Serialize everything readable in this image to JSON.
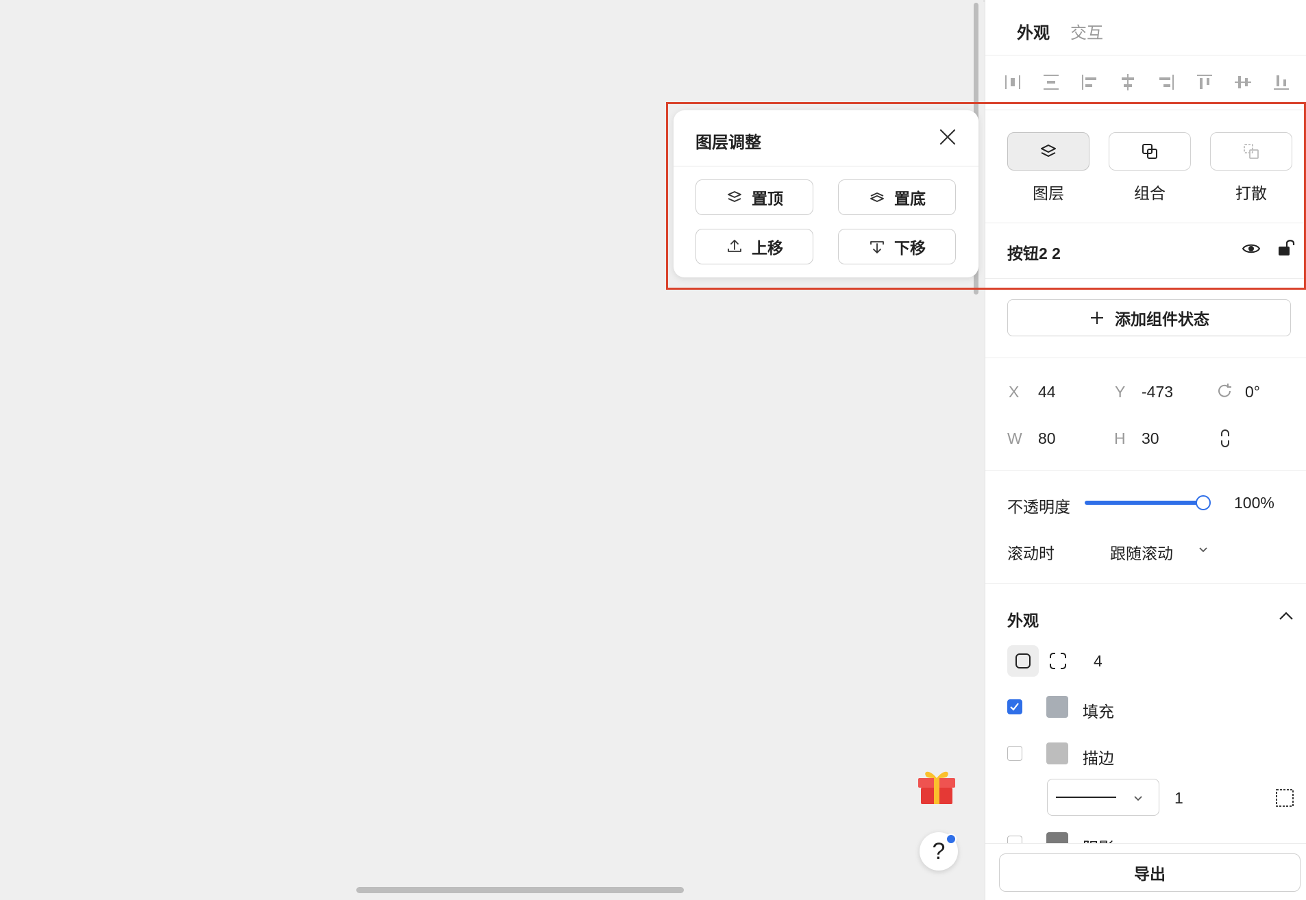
{
  "popover": {
    "title": "图层调整",
    "buttons": [
      {
        "label": "置顶",
        "icon": "bring-to-front-icon"
      },
      {
        "label": "置底",
        "icon": "send-to-back-icon"
      },
      {
        "label": "上移",
        "icon": "move-up-icon"
      },
      {
        "label": "下移",
        "icon": "move-down-icon"
      }
    ]
  },
  "panel": {
    "tabs": [
      {
        "label": "外观",
        "active": true
      },
      {
        "label": "交互",
        "active": false
      }
    ],
    "align_icons": [
      "distribute-horizontal-icon",
      "distribute-vertical-icon",
      "align-left-icon",
      "align-center-horizontal-icon",
      "align-right-icon",
      "align-top-icon",
      "align-middle-vertical-icon",
      "align-bottom-icon"
    ],
    "group_actions": [
      {
        "label": "图层",
        "icon": "layers-icon",
        "active": true
      },
      {
        "label": "组合",
        "icon": "group-icon",
        "active": false
      },
      {
        "label": "打散",
        "icon": "ungroup-icon",
        "active": false
      }
    ],
    "layer_name": "按钮2 2",
    "add_state_label": "添加组件状态",
    "geometry": {
      "x_label": "X",
      "x_value": "44",
      "y_label": "Y",
      "y_value": "-473",
      "rotation_value": "0°",
      "w_label": "W",
      "w_value": "80",
      "h_label": "H",
      "h_value": "30"
    },
    "opacity": {
      "label": "不透明度",
      "value": "100%",
      "level": 1.0
    },
    "scroll": {
      "label": "滚动时",
      "value": "跟随滚动"
    },
    "appearance": {
      "title": "外观",
      "corner_radius": "4",
      "fill": {
        "label": "填充",
        "checked": true,
        "color": "#a8aeb5"
      },
      "stroke": {
        "label": "描边",
        "checked": false,
        "color": "#bdbdbd",
        "width": "1"
      },
      "shadow": {
        "label": "阴影",
        "checked": false
      }
    },
    "export_label": "导出"
  },
  "colors": {
    "accent": "#2f6fe8",
    "highlight": "#d9432c"
  }
}
